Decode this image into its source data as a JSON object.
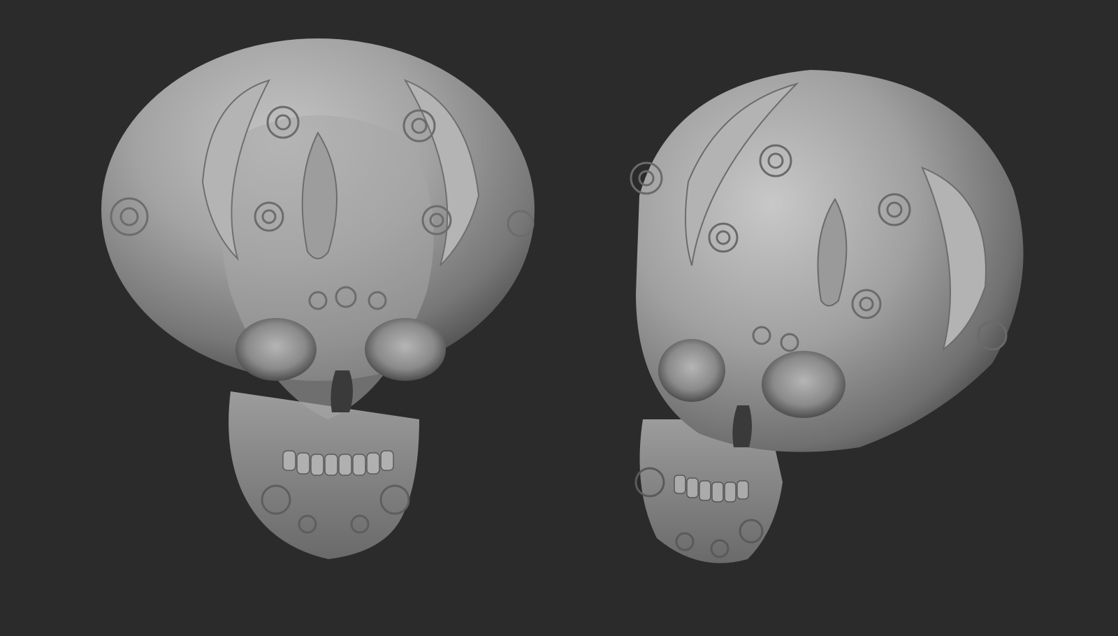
{
  "scene": {
    "background_color": "#2b2b2b",
    "clay_color": "#9a9a9a",
    "renders": [
      {
        "name": "skull-front-view",
        "view": "front"
      },
      {
        "name": "skull-three-quarter-view",
        "view": "three-quarter"
      }
    ]
  }
}
